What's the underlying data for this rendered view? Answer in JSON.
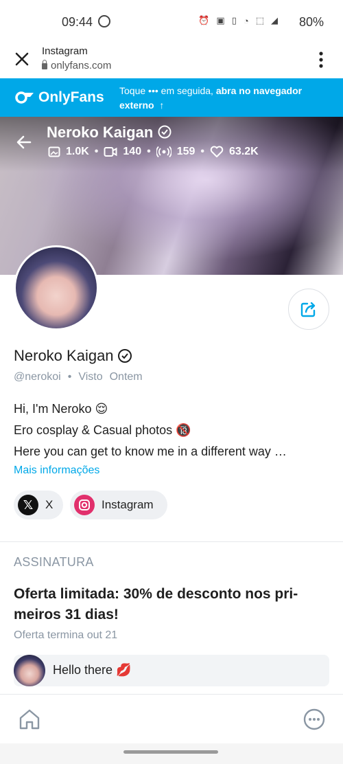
{
  "status_bar": {
    "time": "09:44",
    "battery": "80%",
    "icons": [
      "alarm-icon",
      "auto-icon",
      "vibrate-icon",
      "wifi-icon",
      "volte-icon",
      "signal-icon"
    ]
  },
  "browser": {
    "title": "Instagram",
    "url": "onlyfans.com"
  },
  "banner": {
    "logo": "OnlyFans",
    "note_prefix": "Toque",
    "note_dots": "•••",
    "note_middle": "em seguida,",
    "note_bold": "abra no navegador",
    "note_line2": "externo",
    "accent": "#00a8e8"
  },
  "cover": {
    "name": "Neroko Kaigan",
    "stats": {
      "photos": "1.0K",
      "videos": "140",
      "streams": "159",
      "likes": "63.2K"
    }
  },
  "profile": {
    "name": "Neroko Kaigan",
    "handle": "@nerokoi",
    "seen_label": "Visto",
    "seen_when": "Ontem",
    "bio": [
      "Hi, I'm Neroko 😌",
      "Ero cosplay & Casual photos 🔞",
      "Here you can get to know me in a different way …"
    ],
    "more_info": "Mais informações",
    "social": [
      {
        "label": "X",
        "icon": "x-icon"
      },
      {
        "label": "Instagram",
        "icon": "instagram-icon"
      }
    ]
  },
  "subscription": {
    "header": "ASSINATURA",
    "offer_title": "Oferta limitada: 30% de desconto nos pri-meiros 31 dias!",
    "offer_ends": "Oferta termina out 21",
    "message": "Hello there 💋"
  },
  "nav": {
    "icons": [
      "home-icon",
      "more-icon"
    ]
  }
}
